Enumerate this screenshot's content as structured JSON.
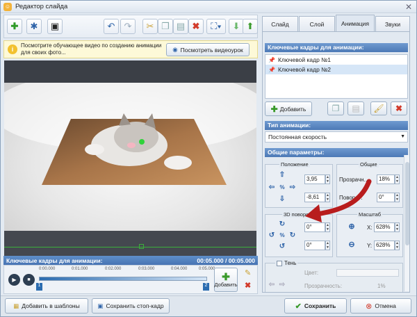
{
  "window": {
    "title": "Редактор слайда",
    "close": "✕"
  },
  "notice": {
    "text": "Посмотрите обучающее видео по созданию анимации для своих фото...",
    "button": "Посмотреть видеоурок"
  },
  "timeline": {
    "title": "Ключевые кадры для анимации:",
    "time": "00:05.000 / 00:05.000",
    "ticks": [
      "0:00.000",
      "0:01.000",
      "0:02.000",
      "0:03.000",
      "0:04.000",
      "0:05.000"
    ],
    "markers": [
      "1",
      "2"
    ],
    "add_label": "Добавить"
  },
  "bottom": {
    "add_template": "Добавить в шаблоны",
    "save_frame": "Сохранить стоп-кадр",
    "save": "Сохранить",
    "cancel": "Отмена"
  },
  "tabs": {
    "slide": "Слайд",
    "layer": "Слой",
    "animation": "Анимация",
    "sounds": "Звуки"
  },
  "panel": {
    "keyframes_title": "Ключевые кадры для анимации:",
    "keyframes": [
      "Ключевой кадр №1",
      "Ключевой кадр №2"
    ],
    "add_btn": "Добавить",
    "anim_type_title": "Тип анимации:",
    "anim_type_value": "Постоянная скорость",
    "general_title": "Общие параметры:",
    "position_label": "Положение",
    "general_label": "Общие",
    "pos_x": "3,95",
    "pos_y": "-8,61",
    "transparency_label": "Прозрачн...",
    "transparency_value": "18%",
    "rotation_label": "Поворот:",
    "rotation_value": "0°",
    "rot3d_label": "3D поворот",
    "rot3d_a": "0°",
    "rot3d_b": "0°",
    "scale_label": "Масштаб",
    "scale_x_label": "X:",
    "scale_x": "628%",
    "scale_y_label": "Y:",
    "scale_y": "628%",
    "shadow_label": "Тень",
    "color_label": "Цвет:",
    "shadow_transparency_label": "Прозрачность:",
    "shadow_transparency": "1%"
  },
  "colors": {
    "accent": "#4c79b6",
    "save_green": "#3a9a2a",
    "cancel_red": "#d23b2b"
  }
}
